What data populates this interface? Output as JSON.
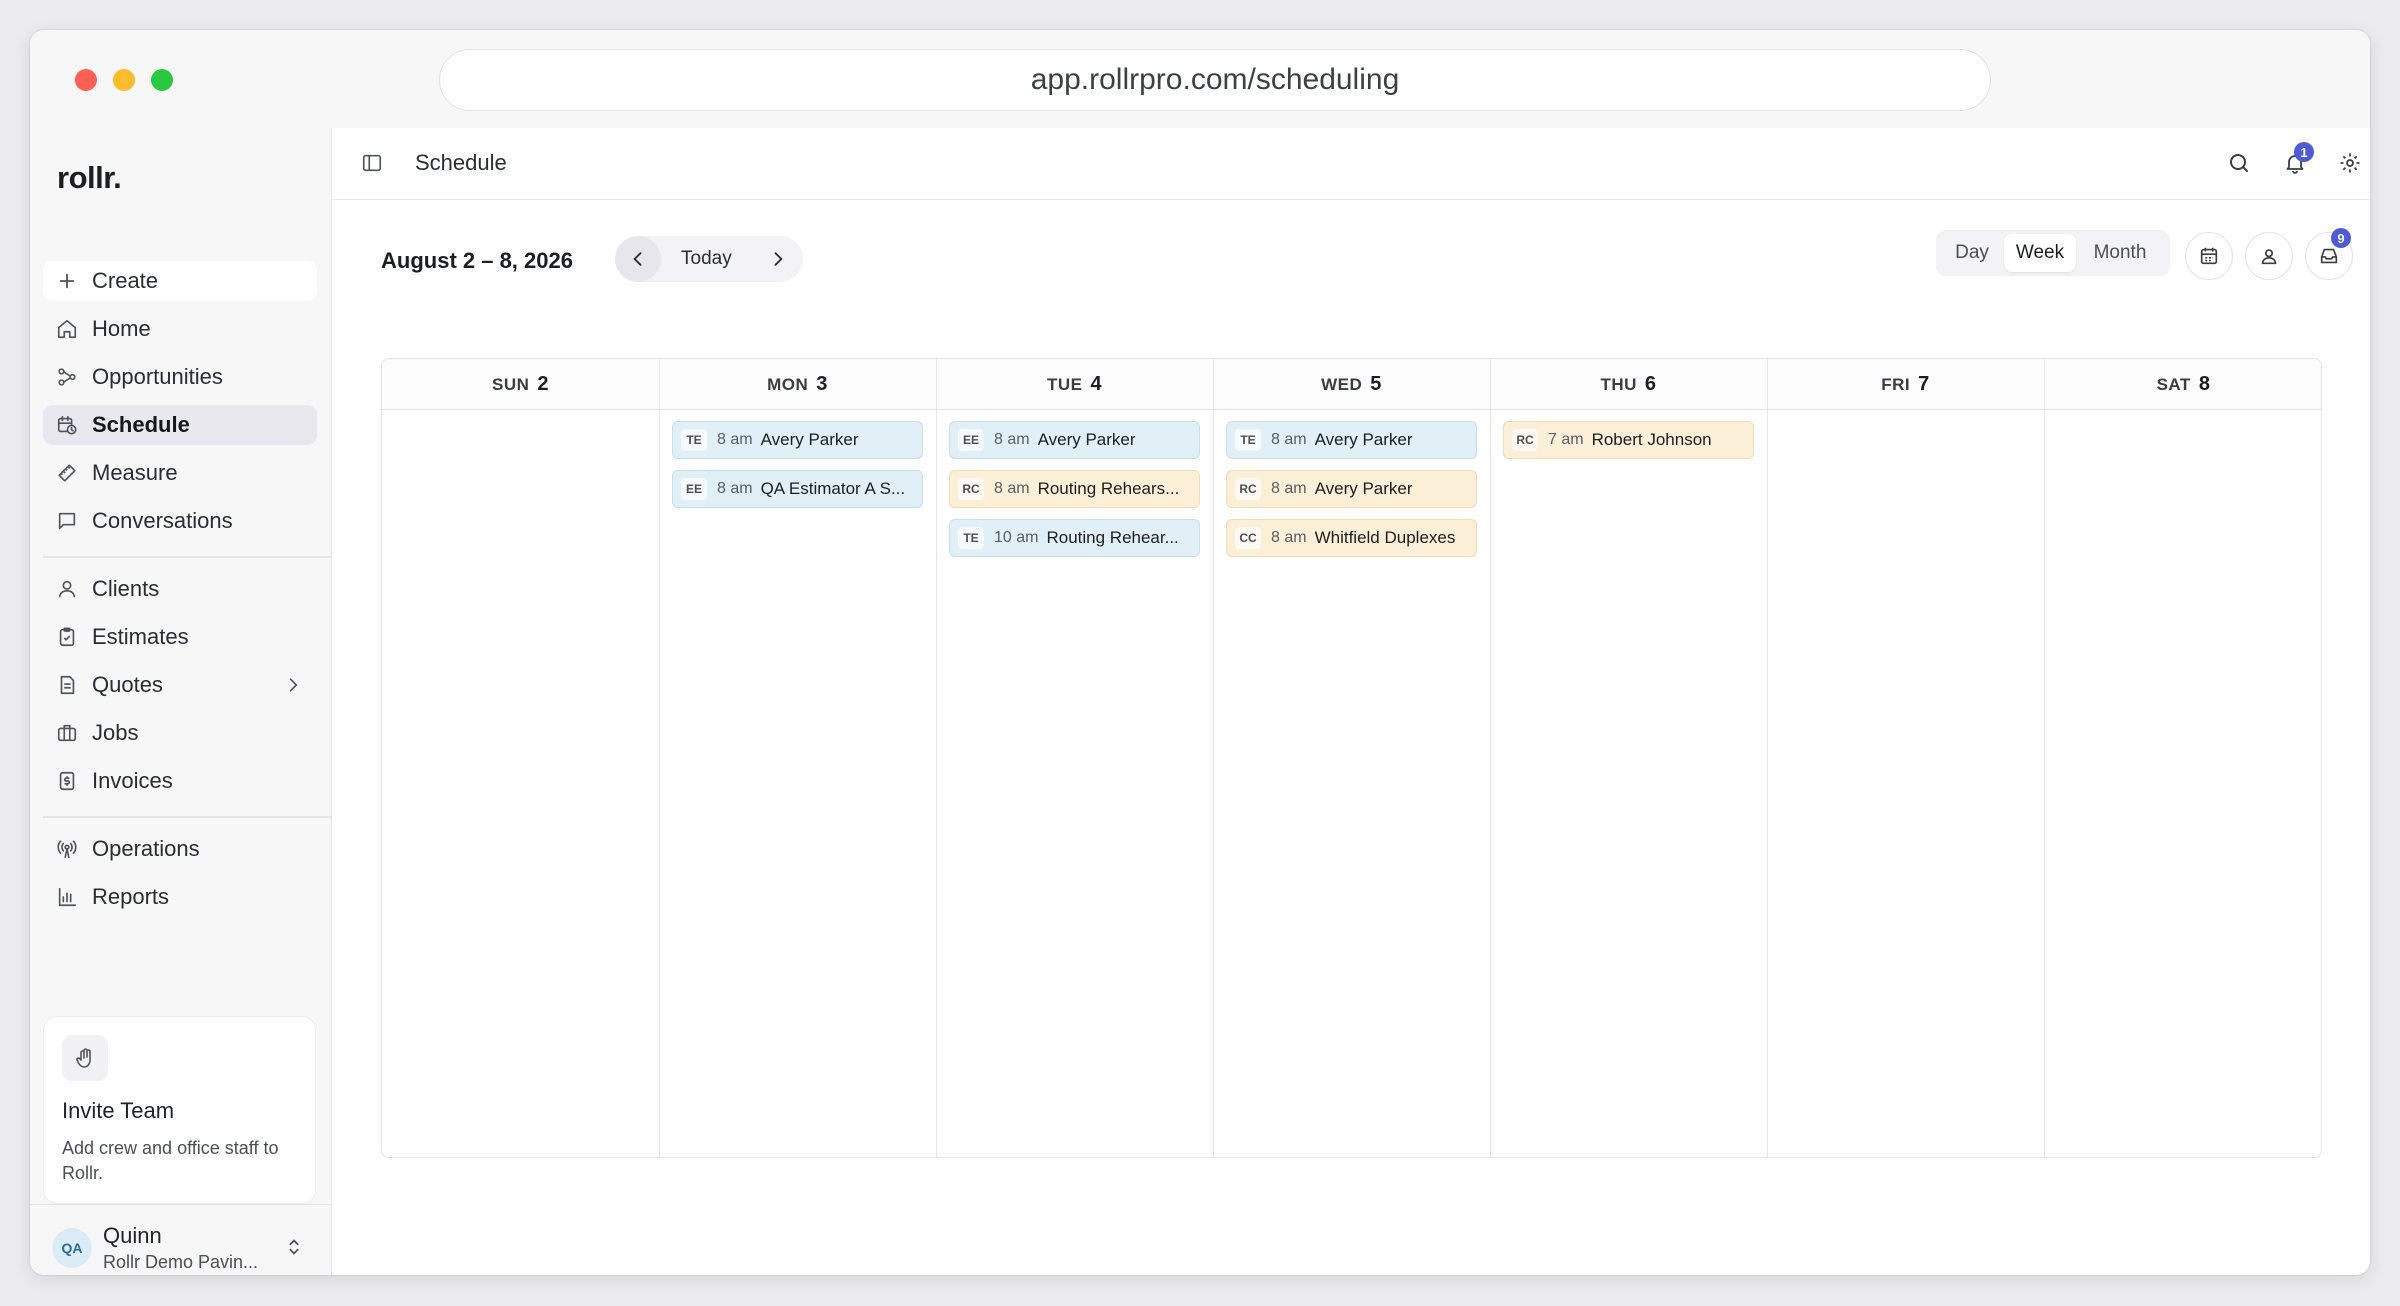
{
  "browser": {
    "url": "app.rollrpro.com/scheduling"
  },
  "sidebar": {
    "brand": "rollr.",
    "create_label": "Create",
    "items": [
      {
        "label": "Home"
      },
      {
        "label": "Opportunities"
      },
      {
        "label": "Schedule"
      },
      {
        "label": "Measure"
      },
      {
        "label": "Conversations"
      },
      {
        "label": "Clients"
      },
      {
        "label": "Estimates"
      },
      {
        "label": "Quotes"
      },
      {
        "label": "Jobs"
      },
      {
        "label": "Invoices"
      },
      {
        "label": "Operations"
      },
      {
        "label": "Reports"
      }
    ],
    "invite": {
      "title": "Invite Team",
      "description": "Add crew and office staff to Rollr."
    },
    "user": {
      "initials": "QA",
      "name": "Quinn",
      "org": "Rollr Demo Pavin..."
    }
  },
  "topbar": {
    "title": "Schedule",
    "notification_count": "1"
  },
  "toolbar": {
    "range": "August 2 – 8, 2026",
    "today_label": "Today",
    "views": {
      "day": "Day",
      "week": "Week",
      "month": "Month"
    },
    "inbox_count": "9"
  },
  "calendar": {
    "days": [
      {
        "dow": "SUN",
        "num": "2"
      },
      {
        "dow": "MON",
        "num": "3"
      },
      {
        "dow": "TUE",
        "num": "4"
      },
      {
        "dow": "WED",
        "num": "5"
      },
      {
        "dow": "THU",
        "num": "6"
      },
      {
        "dow": "FRI",
        "num": "7"
      },
      {
        "dow": "SAT",
        "num": "8"
      }
    ],
    "events": {
      "mon": [
        {
          "tag": "TE",
          "time": "8 am",
          "title": "Avery Parker"
        },
        {
          "tag": "EE",
          "time": "8 am",
          "title": "QA Estimator A S..."
        }
      ],
      "tue": [
        {
          "tag": "EE",
          "time": "8 am",
          "title": "Avery Parker"
        },
        {
          "tag": "RC",
          "time": "8 am",
          "title": "Routing Rehears..."
        },
        {
          "tag": "TE",
          "time": "10 am",
          "title": "Routing Rehear..."
        }
      ],
      "wed": [
        {
          "tag": "TE",
          "time": "8 am",
          "title": "Avery Parker"
        },
        {
          "tag": "RC",
          "time": "8 am",
          "title": "Avery Parker"
        },
        {
          "tag": "CC",
          "time": "8 am",
          "title": "Whitfield Duplexes"
        }
      ],
      "thu": [
        {
          "tag": "RC",
          "time": "7 am",
          "title": "Robert Johnson"
        }
      ]
    }
  },
  "colors": {
    "accent": "#4f5bd5",
    "event_blue": "#e1eff7",
    "event_orange": "#fcefd8"
  }
}
